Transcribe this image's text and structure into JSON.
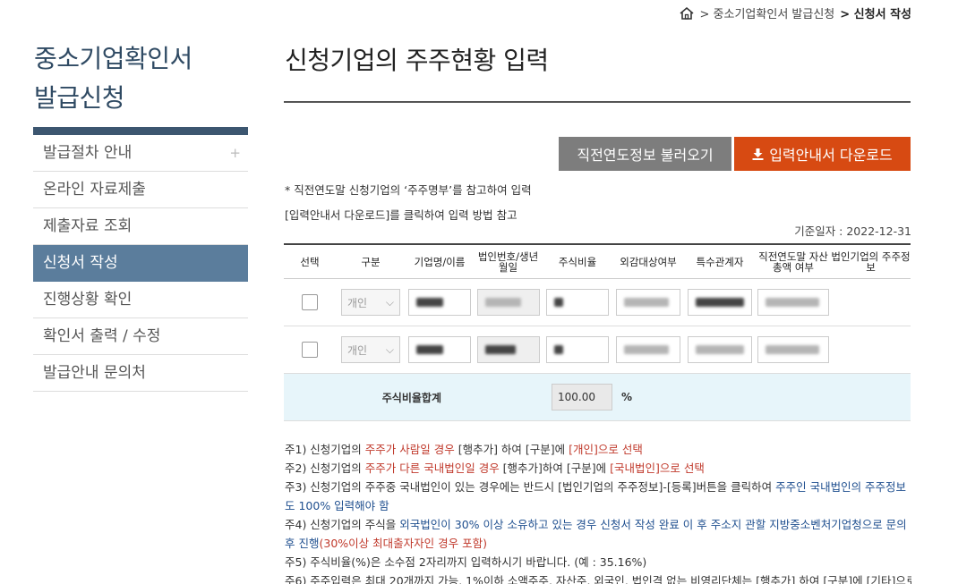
{
  "breadcrumb": {
    "home_icon": "home-icon",
    "item1": "> 중소기업확인서 발급신청",
    "item2": "> 신청서 작성"
  },
  "sidebar": {
    "title_line1": "중소기업확인서",
    "title_line2": "발급신청",
    "items": [
      {
        "label": "발급절차 안내",
        "plus": "+"
      },
      {
        "label": "온라인 자료제출"
      },
      {
        "label": "제출자료 조회"
      },
      {
        "label": "신청서 작성"
      },
      {
        "label": "진행상황 확인"
      },
      {
        "label": "확인서 출력 / 수정"
      },
      {
        "label": "발급안내 문의처"
      }
    ]
  },
  "main": {
    "title": "신청기업의 주주현황 입력",
    "btn_prev": "직전연도정보 불러오기",
    "btn_download": "입력안내서 다운로드",
    "note1": "* 직전연도말 신청기업의 ‘주주명부’를 참고하여 입력",
    "note2": "[입력안내서 다운로드]를 클릭하여 입력 방법 참고",
    "base_date": "기준일자 : 2022-12-31"
  },
  "table": {
    "headers": [
      "선택",
      "구분",
      "기업명/이름",
      "법인번호/생년월일",
      "주식비율",
      "외감대상여부",
      "특수관계자",
      "직전연도말 자산총액 여부",
      "법인기업의 주주정보"
    ],
    "rows": [
      {
        "type": "개인"
      },
      {
        "type": "개인"
      }
    ],
    "sum_label": "주식비율합계",
    "sum_value": "100.00",
    "sum_unit": "%"
  },
  "notes": {
    "n1a": "주1) 신청기업의 ",
    "n1b": "주주가 사람일 경우",
    "n1c": " [행추가] 하여 [구분]에 ",
    "n1d": "[개인]으로 선택",
    "n2a": "주2) 신청기업의 ",
    "n2b": "주주가 다른 국내법인일 경우",
    "n2c": " [행추가]하여 [구분]에 ",
    "n2d": "[국내법인]으로 선택",
    "n3a": "주3) 신청기업의 주주중 국내법인이 있는 경우에는 반드시 [법인기업의 주주정보]-[등록]버튼을 클릭하여 ",
    "n3b": "주주인 국내법인의 주주정보도 100% 입력해야 함",
    "n4a": "주4) 신청기업의 주식을 ",
    "n4b": "외국법인이 30% 이상 소유하고 있는 경우 신청서 작성 완료 이 후 주소지 관할 지방중소벤처기업청으로 문의 후 진행",
    "n4c": "(30%이상 최대출자자인 경우 포함)",
    "n5": "주5) 주식비율(%)은 소수점 2자리까지 입력하시기 바랍니다. (예 : 35.16%)",
    "n6": "주6) 주주입력은 최대 20개까지 가능, 1%이하 소액주주, 자산주, 외국인, 법인격 없는 비영리단체는 [행추가] 하여 [구분]에 [기타]으로 선"
  },
  "colors": {
    "sidebar_active": "#5b7d9c",
    "download_button": "#d74a12",
    "prev_button": "#7d7d7d",
    "sum_row": "#e7f5fa"
  }
}
